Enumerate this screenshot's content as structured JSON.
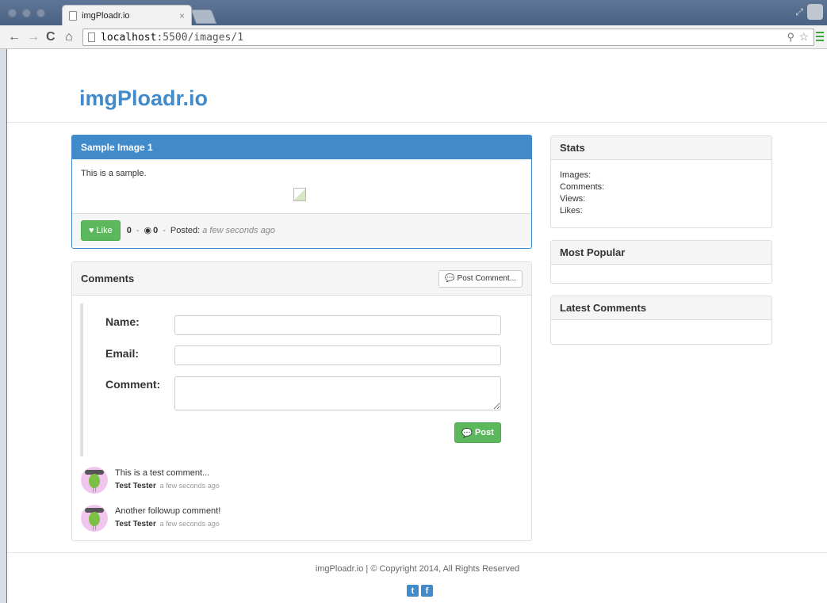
{
  "browser": {
    "tab_title": "imgPloadr.io",
    "tab_close": "×",
    "url_host": "localhost",
    "url_path": ":5500/images/1"
  },
  "site": {
    "brand": "imgPloadr.io"
  },
  "image_panel": {
    "title": "Sample Image 1",
    "description": "This is a sample.",
    "like_label": "Like",
    "likes": "0",
    "views": "0",
    "posted_label": "Posted:",
    "posted_time": "a few seconds ago"
  },
  "comments_panel": {
    "title": "Comments",
    "post_comment_label": "Post Comment...",
    "form": {
      "name_label": "Name:",
      "email_label": "Email:",
      "comment_label": "Comment:",
      "name_value": "",
      "email_value": "",
      "comment_value": "",
      "post_label": "Post"
    },
    "comments": [
      {
        "text": "This is a test comment...",
        "author": "Test Tester",
        "time": "a few seconds ago"
      },
      {
        "text": "Another followup comment!",
        "author": "Test Tester",
        "time": "a few seconds ago"
      }
    ]
  },
  "sidebar": {
    "stats": {
      "title": "Stats",
      "images_label": "Images:",
      "comments_label": "Comments:",
      "views_label": "Views:",
      "likes_label": "Likes:"
    },
    "popular": {
      "title": "Most Popular"
    },
    "latest": {
      "title": "Latest Comments"
    }
  },
  "footer": {
    "text": "imgPloadr.io | © Copyright 2014, All Rights Reserved"
  },
  "colors": {
    "primary": "#428bca",
    "success": "#5cb85c"
  },
  "icons": {
    "twitter": "twitter-icon",
    "facebook": "facebook-icon"
  }
}
